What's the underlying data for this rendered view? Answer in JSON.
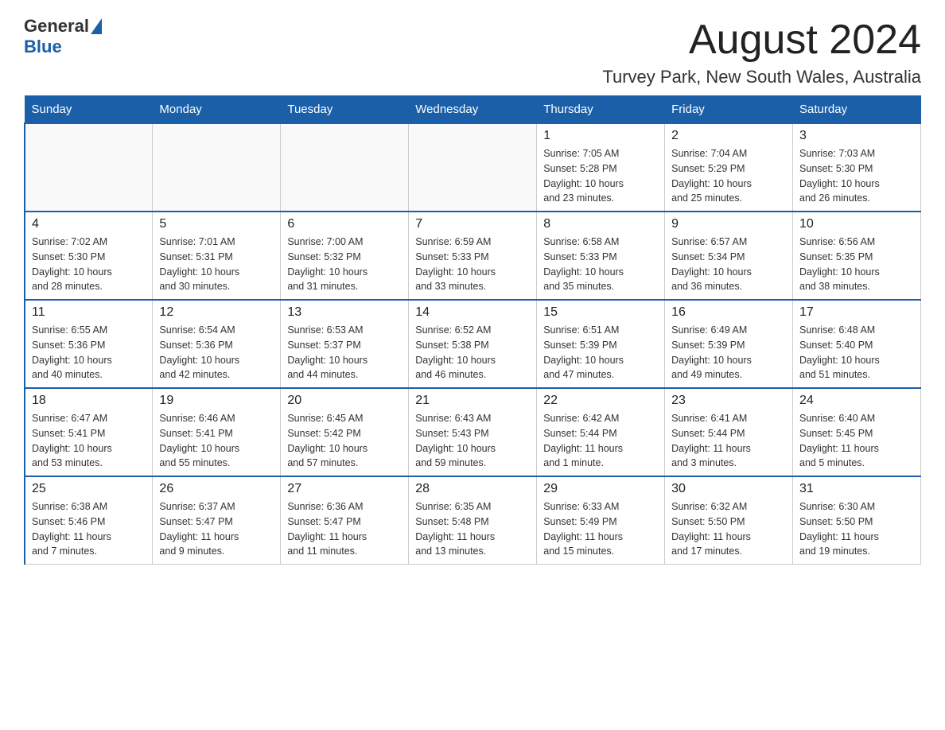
{
  "header": {
    "logo_general": "General",
    "logo_blue": "Blue",
    "month": "August 2024",
    "location": "Turvey Park, New South Wales, Australia"
  },
  "weekdays": [
    "Sunday",
    "Monday",
    "Tuesday",
    "Wednesday",
    "Thursday",
    "Friday",
    "Saturday"
  ],
  "weeks": [
    [
      {
        "day": "",
        "info": ""
      },
      {
        "day": "",
        "info": ""
      },
      {
        "day": "",
        "info": ""
      },
      {
        "day": "",
        "info": ""
      },
      {
        "day": "1",
        "info": "Sunrise: 7:05 AM\nSunset: 5:28 PM\nDaylight: 10 hours\nand 23 minutes."
      },
      {
        "day": "2",
        "info": "Sunrise: 7:04 AM\nSunset: 5:29 PM\nDaylight: 10 hours\nand 25 minutes."
      },
      {
        "day": "3",
        "info": "Sunrise: 7:03 AM\nSunset: 5:30 PM\nDaylight: 10 hours\nand 26 minutes."
      }
    ],
    [
      {
        "day": "4",
        "info": "Sunrise: 7:02 AM\nSunset: 5:30 PM\nDaylight: 10 hours\nand 28 minutes."
      },
      {
        "day": "5",
        "info": "Sunrise: 7:01 AM\nSunset: 5:31 PM\nDaylight: 10 hours\nand 30 minutes."
      },
      {
        "day": "6",
        "info": "Sunrise: 7:00 AM\nSunset: 5:32 PM\nDaylight: 10 hours\nand 31 minutes."
      },
      {
        "day": "7",
        "info": "Sunrise: 6:59 AM\nSunset: 5:33 PM\nDaylight: 10 hours\nand 33 minutes."
      },
      {
        "day": "8",
        "info": "Sunrise: 6:58 AM\nSunset: 5:33 PM\nDaylight: 10 hours\nand 35 minutes."
      },
      {
        "day": "9",
        "info": "Sunrise: 6:57 AM\nSunset: 5:34 PM\nDaylight: 10 hours\nand 36 minutes."
      },
      {
        "day": "10",
        "info": "Sunrise: 6:56 AM\nSunset: 5:35 PM\nDaylight: 10 hours\nand 38 minutes."
      }
    ],
    [
      {
        "day": "11",
        "info": "Sunrise: 6:55 AM\nSunset: 5:36 PM\nDaylight: 10 hours\nand 40 minutes."
      },
      {
        "day": "12",
        "info": "Sunrise: 6:54 AM\nSunset: 5:36 PM\nDaylight: 10 hours\nand 42 minutes."
      },
      {
        "day": "13",
        "info": "Sunrise: 6:53 AM\nSunset: 5:37 PM\nDaylight: 10 hours\nand 44 minutes."
      },
      {
        "day": "14",
        "info": "Sunrise: 6:52 AM\nSunset: 5:38 PM\nDaylight: 10 hours\nand 46 minutes."
      },
      {
        "day": "15",
        "info": "Sunrise: 6:51 AM\nSunset: 5:39 PM\nDaylight: 10 hours\nand 47 minutes."
      },
      {
        "day": "16",
        "info": "Sunrise: 6:49 AM\nSunset: 5:39 PM\nDaylight: 10 hours\nand 49 minutes."
      },
      {
        "day": "17",
        "info": "Sunrise: 6:48 AM\nSunset: 5:40 PM\nDaylight: 10 hours\nand 51 minutes."
      }
    ],
    [
      {
        "day": "18",
        "info": "Sunrise: 6:47 AM\nSunset: 5:41 PM\nDaylight: 10 hours\nand 53 minutes."
      },
      {
        "day": "19",
        "info": "Sunrise: 6:46 AM\nSunset: 5:41 PM\nDaylight: 10 hours\nand 55 minutes."
      },
      {
        "day": "20",
        "info": "Sunrise: 6:45 AM\nSunset: 5:42 PM\nDaylight: 10 hours\nand 57 minutes."
      },
      {
        "day": "21",
        "info": "Sunrise: 6:43 AM\nSunset: 5:43 PM\nDaylight: 10 hours\nand 59 minutes."
      },
      {
        "day": "22",
        "info": "Sunrise: 6:42 AM\nSunset: 5:44 PM\nDaylight: 11 hours\nand 1 minute."
      },
      {
        "day": "23",
        "info": "Sunrise: 6:41 AM\nSunset: 5:44 PM\nDaylight: 11 hours\nand 3 minutes."
      },
      {
        "day": "24",
        "info": "Sunrise: 6:40 AM\nSunset: 5:45 PM\nDaylight: 11 hours\nand 5 minutes."
      }
    ],
    [
      {
        "day": "25",
        "info": "Sunrise: 6:38 AM\nSunset: 5:46 PM\nDaylight: 11 hours\nand 7 minutes."
      },
      {
        "day": "26",
        "info": "Sunrise: 6:37 AM\nSunset: 5:47 PM\nDaylight: 11 hours\nand 9 minutes."
      },
      {
        "day": "27",
        "info": "Sunrise: 6:36 AM\nSunset: 5:47 PM\nDaylight: 11 hours\nand 11 minutes."
      },
      {
        "day": "28",
        "info": "Sunrise: 6:35 AM\nSunset: 5:48 PM\nDaylight: 11 hours\nand 13 minutes."
      },
      {
        "day": "29",
        "info": "Sunrise: 6:33 AM\nSunset: 5:49 PM\nDaylight: 11 hours\nand 15 minutes."
      },
      {
        "day": "30",
        "info": "Sunrise: 6:32 AM\nSunset: 5:50 PM\nDaylight: 11 hours\nand 17 minutes."
      },
      {
        "day": "31",
        "info": "Sunrise: 6:30 AM\nSunset: 5:50 PM\nDaylight: 11 hours\nand 19 minutes."
      }
    ]
  ]
}
